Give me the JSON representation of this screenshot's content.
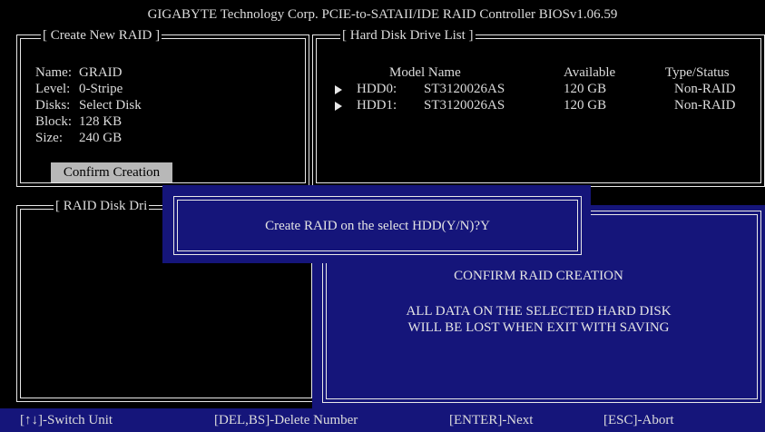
{
  "header": {
    "title": "GIGABYTE Technology Corp. PCIE-to-SATAII/IDE RAID Controller BIOSv1.06.59"
  },
  "create_panel": {
    "title": "[ Create New RAID ]",
    "fields": [
      {
        "label": "Name:",
        "value": "GRAID"
      },
      {
        "label": "Level:",
        "value": "0-Stripe"
      },
      {
        "label": "Disks:",
        "value": "Select Disk"
      },
      {
        "label": "Block:",
        "value": "128 KB"
      },
      {
        "label": "Size:",
        "value": "240 GB"
      }
    ],
    "confirm_label": "Confirm Creation"
  },
  "hdd_panel": {
    "title": "[ Hard Disk Drive List ]",
    "headers": {
      "model": "Model Name",
      "available": "Available",
      "type": "Type/Status"
    },
    "rows": [
      {
        "id": "HDD0:",
        "model": "ST3120026AS",
        "available": "120 GB",
        "type": "Non-RAID"
      },
      {
        "id": "HDD1:",
        "model": "ST3120026AS",
        "available": "120 GB",
        "type": "Non-RAID"
      }
    ]
  },
  "raid_disk_panel": {
    "title": "[ RAID Disk Dri"
  },
  "dialog": {
    "prompt": "Create RAID on the select HDD(Y/N)?Y"
  },
  "warning": {
    "heading": "CONFIRM RAID CREATION",
    "line1": "ALL DATA ON THE SELECTED HARD DISK",
    "line2": "WILL BE LOST WHEN EXIT WITH SAVING"
  },
  "footer": {
    "switch": "[↑↓]-Switch Unit",
    "delete": "[DEL,BS]-Delete Number",
    "next": "[ENTER]-Next",
    "abort": "[ESC]-Abort"
  },
  "colors": {
    "background": "#000000",
    "dialog_blue": "#15157a",
    "text": "#dcdcdc",
    "button": "#b8b8b8"
  }
}
